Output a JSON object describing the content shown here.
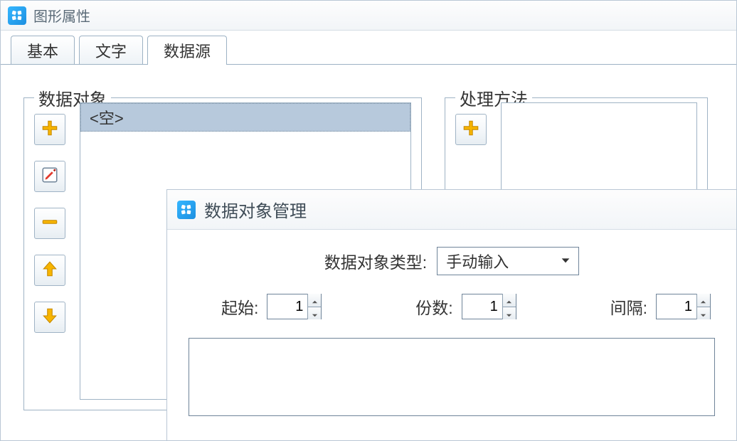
{
  "window": {
    "title": "图形属性"
  },
  "tabs": {
    "basic": "基本",
    "text": "文字",
    "datasource": "数据源"
  },
  "group_data": {
    "legend": "数据对象",
    "items": [
      "<空>"
    ]
  },
  "group_proc": {
    "legend": "处理方法"
  },
  "dialog": {
    "title": "数据对象管理",
    "type_label": "数据对象类型:",
    "type_value": "手动输入",
    "start_label": "起始:",
    "start_value": "1",
    "copies_label": "份数:",
    "copies_value": "1",
    "gap_label": "间隔:",
    "gap_value": "1"
  }
}
